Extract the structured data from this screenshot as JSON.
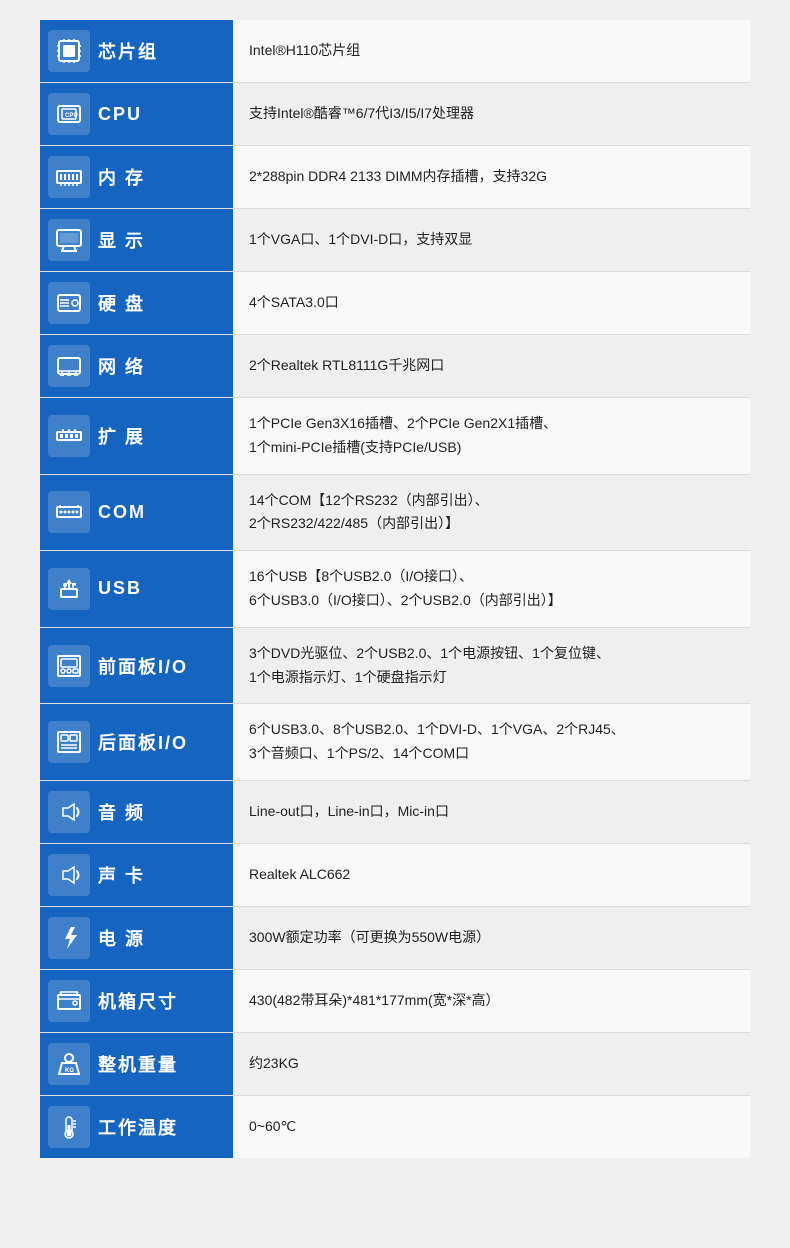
{
  "rows": [
    {
      "id": "chipset",
      "icon": "⬛",
      "iconSymbol": "chip",
      "label": "芯片组",
      "value": "Intel®H110芯片组"
    },
    {
      "id": "cpu",
      "icon": "🖥",
      "iconSymbol": "cpu",
      "label": "CPU",
      "value": "支持Intel®酷睿™6/7代I3/I5/I7处理器"
    },
    {
      "id": "memory",
      "icon": "🔳",
      "iconSymbol": "memory",
      "label": "内  存",
      "value": "2*288pin DDR4 2133 DIMM内存插槽，支持32G"
    },
    {
      "id": "display",
      "icon": "🖵",
      "iconSymbol": "display",
      "label": "显  示",
      "value": "1个VGA口、1个DVI-D口，支持双显"
    },
    {
      "id": "harddisk",
      "icon": "💾",
      "iconSymbol": "harddisk",
      "label": "硬  盘",
      "value": "4个SATA3.0口"
    },
    {
      "id": "network",
      "icon": "🌐",
      "iconSymbol": "network",
      "label": "网  络",
      "value": "2个Realtek RTL8111G千兆网口"
    },
    {
      "id": "expand",
      "icon": "🔌",
      "iconSymbol": "expand",
      "label": "扩  展",
      "value": "1个PCIe Gen3X16插槽、2个PCIe Gen2X1插槽、\n1个mini-PCIe插槽(支持PCIe/USB)"
    },
    {
      "id": "com",
      "icon": "🔗",
      "iconSymbol": "com",
      "label": "COM",
      "value": "14个COM【12个RS232（内部引出）、\n2个RS232/422/485（内部引出）】"
    },
    {
      "id": "usb",
      "icon": "⇌",
      "iconSymbol": "usb",
      "label": "USB",
      "value": "16个USB【8个USB2.0（I/O接口）、\n6个USB3.0（I/O接口）、2个USB2.0（内部引出）】"
    },
    {
      "id": "frontpanel",
      "icon": "📋",
      "iconSymbol": "frontpanel",
      "label": "前面板I/O",
      "value": "3个DVD光驱位、2个USB2.0、1个电源按钮、1个复位键、\n1个电源指示灯、1个硬盘指示灯"
    },
    {
      "id": "rearpanel",
      "icon": "📋",
      "iconSymbol": "rearpanel",
      "label": "后面板I/O",
      "value": "6个USB3.0、8个USB2.0、1个DVI-D、1个VGA、2个RJ45、\n3个音频口、1个PS/2、14个COM口"
    },
    {
      "id": "audio",
      "icon": "🔊",
      "iconSymbol": "audio",
      "label": "音  频",
      "value": "Line-out口，Line-in口，Mic-in口"
    },
    {
      "id": "soundcard",
      "icon": "🔊",
      "iconSymbol": "soundcard",
      "label": "声  卡",
      "value": "Realtek ALC662"
    },
    {
      "id": "power",
      "icon": "⚡",
      "iconSymbol": "power",
      "label": "电  源",
      "value": "300W额定功率（可更换为550W电源）"
    },
    {
      "id": "chassis",
      "icon": "📦",
      "iconSymbol": "chassis",
      "label": "机箱尺寸",
      "value": "430(482带耳朵)*481*177mm(宽*深*高）"
    },
    {
      "id": "weight",
      "icon": "⚖",
      "iconSymbol": "weight",
      "label": "整机重量",
      "value": "约23KG"
    },
    {
      "id": "temp",
      "icon": "🌡",
      "iconSymbol": "temp",
      "label": "工作温度",
      "value": "0~60℃"
    }
  ]
}
